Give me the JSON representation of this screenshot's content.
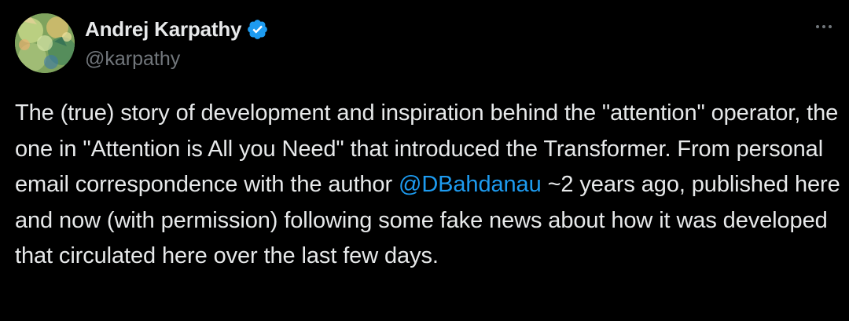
{
  "tweet": {
    "author": {
      "display_name": "Andrej Karpathy",
      "handle": "@karpathy",
      "verified": true,
      "avatar_icon": "profile-avatar"
    },
    "more_icon": "more-options-icon",
    "text": {
      "part1": "The (true) story of development and inspiration behind the \"attention\" operator, the one in \"Attention is All you Need\" that introduced the Transformer. From personal email correspondence with the author ",
      "mention": "@DBahdanau",
      "part2": " ~2 years ago, published here and now (with permission) following some fake news about how it was developed that circulated here over the last few days."
    }
  },
  "colors": {
    "background": "#000000",
    "text_primary": "#e7e9ea",
    "text_secondary": "#71767b",
    "accent": "#1d9bf0"
  }
}
